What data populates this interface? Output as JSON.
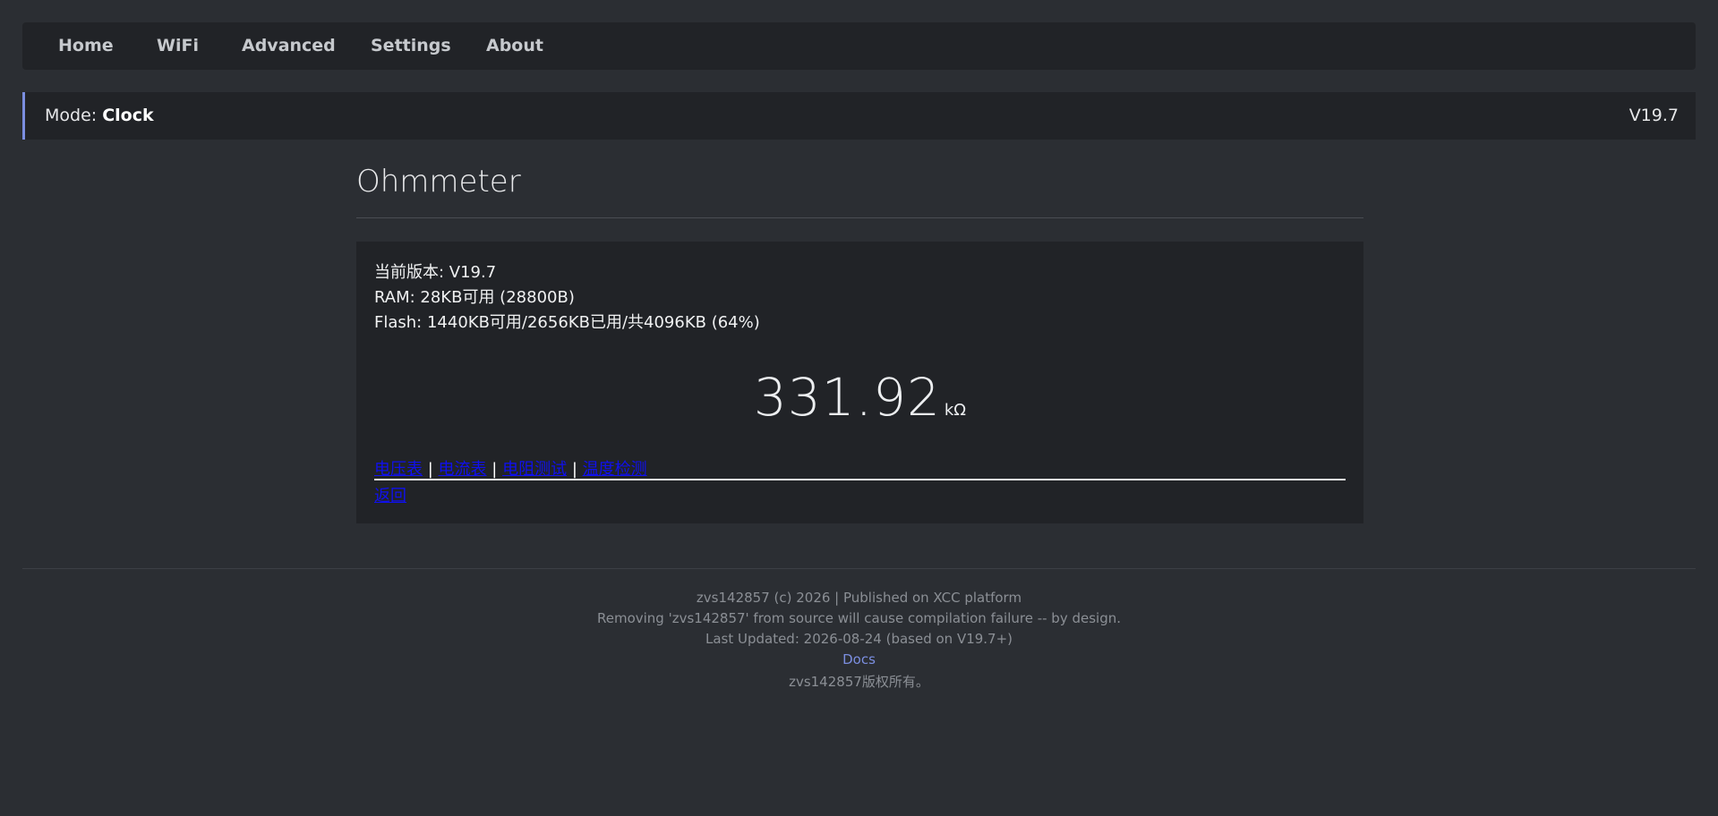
{
  "nav": {
    "items": [
      {
        "label": "Home"
      },
      {
        "label": "WiFi"
      },
      {
        "label": "Advanced"
      },
      {
        "label": "Settings"
      },
      {
        "label": "About"
      }
    ]
  },
  "status": {
    "mode_label": "Mode:",
    "mode_value": "Clock",
    "version": "V19.7"
  },
  "page": {
    "title": "Ohmmeter"
  },
  "info": {
    "version_line": "当前版本: V19.7",
    "ram_line": "RAM: 28KB可用 (28800B)",
    "flash_line": "Flash: 1440KB可用/2656KB已用/共4096KB (64%)"
  },
  "reading": {
    "value": "331.92",
    "unit": "kΩ"
  },
  "links": {
    "items": [
      {
        "label": "电压表"
      },
      {
        "label": "电流表"
      },
      {
        "label": "电阻测试"
      },
      {
        "label": "温度检测"
      }
    ],
    "separator": "|",
    "back_label": "返回"
  },
  "footer": {
    "line1": "zvs142857 (c) 2026 | Published on XCC platform",
    "line2": "Removing 'zvs142857' from source will cause compilation failure -- by design.",
    "line3": "Last Updated: 2026-08-24 (based on V19.7+)",
    "docs_label": "Docs",
    "line5": "zvs142857版权所有。"
  },
  "colors": {
    "background": "#2b2e33",
    "panel": "#212327",
    "accent": "#7b8ee0",
    "link": "#1010ee"
  }
}
